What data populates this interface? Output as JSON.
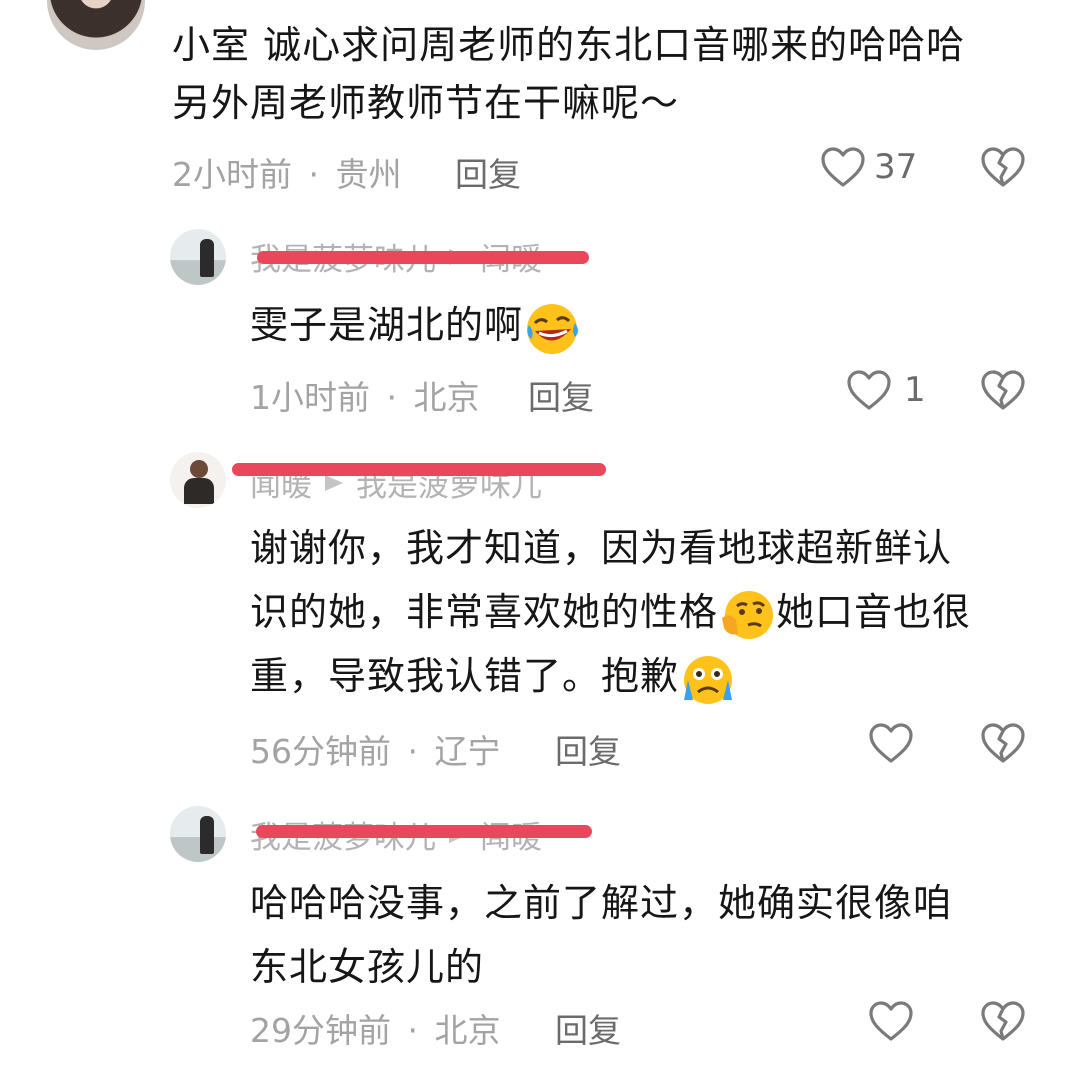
{
  "comments": [
    {
      "text_lines": [
        "小室 诚心求问周老师的东北口音哪来的哈哈哈",
        "另外周老师教师节在干嘛呢～"
      ],
      "time": "2小时前",
      "location": "贵州",
      "reply_label": "回复",
      "likes": "37"
    },
    {
      "user": "我是菠萝味儿",
      "reply_to": "闻暖",
      "text": "雯子是湖北的啊",
      "time": "1小时前",
      "location": "北京",
      "reply_label": "回复",
      "likes": "1"
    },
    {
      "user": "闻暖",
      "reply_to": "我是菠萝味儿",
      "text_lines": [
        "谢谢你，我才知道，因为看地球超新鲜认",
        "识的她，非常喜欢她的性格",
        "她口音也很",
        "重，导致我认错了。抱歉"
      ],
      "time": "56分钟前",
      "location": "辽宁",
      "reply_label": "回复",
      "likes": ""
    },
    {
      "user": "我是菠萝味儿",
      "reply_to": "闻暖",
      "text_lines": [
        "哈哈哈没事，之前了解过，她确实很像咱",
        "东北女孩儿的"
      ],
      "time": "29分钟前",
      "location": "北京",
      "reply_label": "回复",
      "likes": ""
    }
  ],
  "separator": "·",
  "colors": {
    "redact_line": "#e8475c",
    "meta": "#a3a3a3",
    "text": "#161616"
  },
  "icons": [
    "heart-outline-icon",
    "broken-heart-icon",
    "reply-arrow-icon",
    "laughing-crying-emoji",
    "thinking-emoji",
    "crying-emoji"
  ]
}
